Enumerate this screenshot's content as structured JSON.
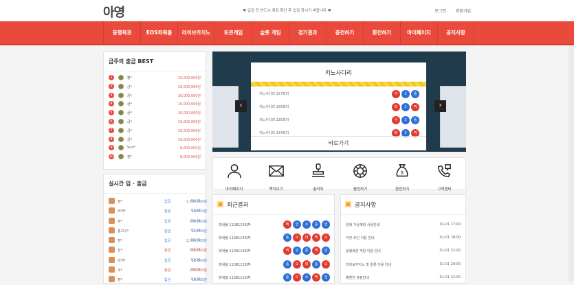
{
  "header": {
    "logo": "아영",
    "notice": "♥ 입금 전 반드시 계좌 확인 후 입금 하시기 바랍니다 ♥",
    "login": "로그인",
    "signup": "회원가입"
  },
  "nav": [
    "동행복권",
    "EOS파워볼",
    "라이브카지노",
    "토큰게임",
    "슬롯 게임",
    "경기결과",
    "충전하기",
    "환전하기",
    "마이페이지",
    "공지사항"
  ],
  "best": {
    "title": "금주의 출금 BEST",
    "rows": [
      {
        "rank": "1",
        "name": "뽕*",
        "amount": "10,000,000원"
      },
      {
        "rank": "2",
        "name": "금*",
        "amount": "10,000,000원"
      },
      {
        "rank": "3",
        "name": "금*",
        "amount": "10,000,000원"
      },
      {
        "rank": "4",
        "name": "금*",
        "amount": "10,000,000원"
      },
      {
        "rank": "5",
        "name": "금*",
        "amount": "10,000,000원"
      },
      {
        "rank": "6",
        "name": "금*",
        "amount": "10,000,000원"
      },
      {
        "rank": "7",
        "name": "금*",
        "amount": "10,000,000원"
      },
      {
        "rank": "8",
        "name": "금*",
        "amount": "10,000,000원"
      },
      {
        "rank": "9",
        "name": "Sun*",
        "amount": "8,000,000원"
      },
      {
        "rank": "10",
        "name": "장*",
        "amount": "8,000,000원"
      }
    ]
  },
  "realtime": {
    "title": "실시간 입 · 출금",
    "rows": [
      {
        "name": "장*",
        "type": "입금",
        "amount": "1,500,000원",
        "date": "01-01"
      },
      {
        "name": "라카*",
        "type": "입금",
        "amount": "13,000원",
        "date": "01-01"
      },
      {
        "name": "파*",
        "type": "입금",
        "amount": "100,000원",
        "date": "01-01"
      },
      {
        "name": "홍고구*",
        "type": "입금",
        "amount": "11,000원",
        "date": "01-01"
      },
      {
        "name": "장*",
        "type": "입금",
        "amount": "2,000,000원",
        "date": "01-01"
      },
      {
        "name": "진*",
        "type": "출금",
        "amount": "140,000원",
        "date": "01-01"
      },
      {
        "name": "라카*",
        "type": "입금",
        "amount": "10,000원",
        "date": "01-01"
      },
      {
        "name": "수*",
        "type": "출금",
        "amount": "200,000원",
        "date": "01-01"
      },
      {
        "name": "장*",
        "type": "입금",
        "amount": "10,000원",
        "date": "01-01"
      }
    ]
  },
  "slider": {
    "title": "키노사다리",
    "bottom": "바로가기",
    "prev": "‹",
    "next": "›",
    "rows": [
      {
        "label": "키노사다리 227회차",
        "balls": [
          {
            "t": "우",
            "c": "red"
          },
          {
            "t": "3",
            "c": "blue"
          },
          {
            "t": "홀",
            "c": "blue"
          }
        ]
      },
      {
        "label": "키노사다리 226회차",
        "balls": [
          {
            "t": "좌",
            "c": "red"
          },
          {
            "t": "3",
            "c": "blue"
          },
          {
            "t": "짝",
            "c": "red"
          }
        ]
      },
      {
        "label": "키노사다리 225회차",
        "balls": [
          {
            "t": "우",
            "c": "red"
          },
          {
            "t": "3",
            "c": "blue"
          },
          {
            "t": "홀",
            "c": "blue"
          }
        ]
      },
      {
        "label": "키노사다리 224회차",
        "balls": [
          {
            "t": "좌",
            "c": "red"
          },
          {
            "t": "3",
            "c": "blue"
          },
          {
            "t": "짝",
            "c": "red"
          }
        ]
      }
    ]
  },
  "icons": [
    {
      "label": "마이페이지",
      "icon": "user-icon"
    },
    {
      "label": "쪽지보기",
      "icon": "envelope-icon"
    },
    {
      "label": "출석부",
      "icon": "stamp-icon"
    },
    {
      "label": "충전하기",
      "icon": "chip-icon"
    },
    {
      "label": "환전하기",
      "icon": "money-bag-icon"
    },
    {
      "label": "고객센터",
      "icon": "phone-chat-icon"
    }
  ],
  "results": {
    "title": "최근결과",
    "rows": [
      {
        "label": "파워볼 1138115회차",
        "balls": [
          {
            "t": "삑",
            "c": "red"
          },
          {
            "t": "언",
            "c": "blue"
          },
          {
            "t": "소",
            "c": "blue"
          },
          {
            "t": "중",
            "c": "blue"
          },
          {
            "t": "언",
            "c": "blue"
          }
        ]
      },
      {
        "label": "파워볼 1138114회차",
        "balls": [
          {
            "t": "홀",
            "c": "blue"
          },
          {
            "t": "오",
            "c": "red"
          },
          {
            "t": "대",
            "c": "red"
          },
          {
            "t": "짝",
            "c": "red"
          },
          {
            "t": "오",
            "c": "red"
          }
        ]
      },
      {
        "label": "파워볼 1138113회차",
        "balls": [
          {
            "t": "짝",
            "c": "red"
          },
          {
            "t": "언",
            "c": "blue"
          },
          {
            "t": "중",
            "c": "blue"
          },
          {
            "t": "짝",
            "c": "red"
          },
          {
            "t": "언",
            "c": "blue"
          }
        ]
      },
      {
        "label": "파워볼 1138112회차",
        "balls": [
          {
            "t": "홀",
            "c": "blue"
          },
          {
            "t": "오",
            "c": "red"
          },
          {
            "t": "대",
            "c": "red"
          },
          {
            "t": "홀",
            "c": "blue"
          },
          {
            "t": "오",
            "c": "red"
          }
        ]
      },
      {
        "label": "파워볼 1138111회차",
        "balls": [
          {
            "t": "홀",
            "c": "blue"
          },
          {
            "t": "오",
            "c": "red"
          },
          {
            "t": "소",
            "c": "blue"
          },
          {
            "t": "짝",
            "c": "red"
          },
          {
            "t": "언",
            "c": "blue"
          }
        ]
      }
    ]
  },
  "notices": {
    "title": "공지사항",
    "rows": [
      {
        "title": "원화 가상계좌 사용안내",
        "date": "01-01 17:00"
      },
      {
        "title": "석앗 코인 이용 안내",
        "date": "01-01 18:00"
      },
      {
        "title": "동행복권 게임 이용 안내",
        "date": "01-01 21:00"
      },
      {
        "title": "라이브카지노 및 슬롯 이용 안내",
        "date": "01-01 20:00"
      },
      {
        "title": "출환전 규정안내",
        "date": "01-01 22:00"
      }
    ]
  },
  "colors": {
    "accent": "#ea4a3c",
    "ball_red": "#e23a2f",
    "ball_blue": "#2d6fd4",
    "deposit": "#3a7bd5",
    "withdraw": "#d9534f"
  }
}
